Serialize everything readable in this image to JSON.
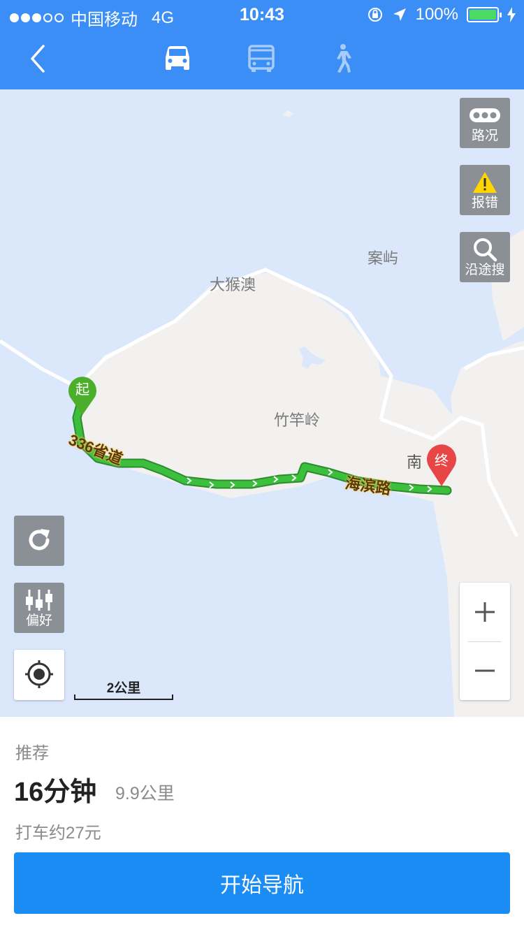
{
  "status_bar": {
    "carrier": "中国移动",
    "network": "4G",
    "time": "10:43",
    "battery": "100%"
  },
  "nav": {
    "modes": [
      "car",
      "bus",
      "walk"
    ],
    "selected_mode": "car"
  },
  "map": {
    "labels": {
      "anyu": "案屿",
      "dahouao": "大猴澳",
      "zhuganling": "竹竿岭",
      "nan": "南",
      "road_336": "336省道",
      "road_haibin": "海滨路"
    },
    "start_marker": "起",
    "end_marker": "终",
    "scale": "2公里",
    "tools": {
      "traffic": "路况",
      "report": "报错",
      "search_along": "沿途搜",
      "preference": "偏好"
    },
    "colors": {
      "water": "#dbe7fb",
      "land": "#f2f1ef",
      "route": "#3cbf3c",
      "start_pin": "#4caf2b",
      "end_pin": "#e84545"
    }
  },
  "route": {
    "tag": "推荐",
    "duration": "16分钟",
    "distance": "9.9公里",
    "taxi": "打车约27元"
  },
  "start_button": "开始导航",
  "colors": {
    "header": "#3b8ef5",
    "button": "#1a8cf4"
  }
}
